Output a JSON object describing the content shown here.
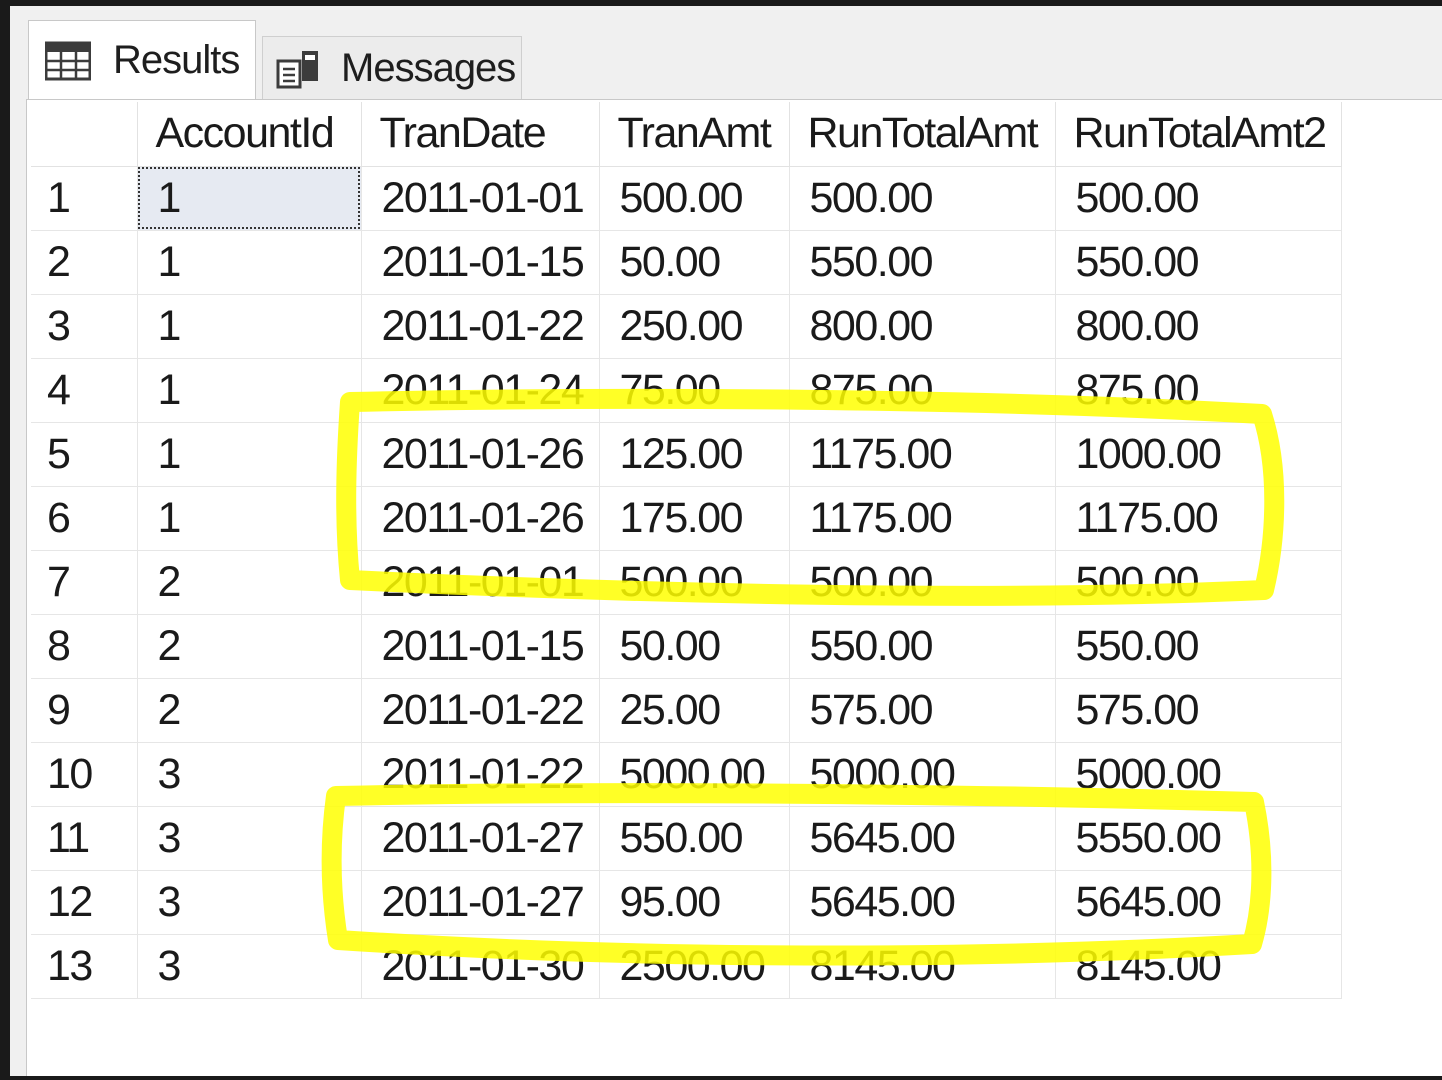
{
  "tabs": [
    {
      "label": "Results",
      "icon": "grid-icon",
      "active": true
    },
    {
      "label": "Messages",
      "icon": "messages-icon",
      "active": false
    }
  ],
  "grid": {
    "columns": [
      "AccountId",
      "TranDate",
      "TranAmt",
      "RunTotalAmt",
      "RunTotalAmt2"
    ],
    "rows": [
      {
        "num": "1",
        "cells": [
          "1",
          "2011-01-01",
          "500.00",
          "500.00",
          "500.00"
        ]
      },
      {
        "num": "2",
        "cells": [
          "1",
          "2011-01-15",
          "50.00",
          "550.00",
          "550.00"
        ]
      },
      {
        "num": "3",
        "cells": [
          "1",
          "2011-01-22",
          "250.00",
          "800.00",
          "800.00"
        ]
      },
      {
        "num": "4",
        "cells": [
          "1",
          "2011-01-24",
          "75.00",
          "875.00",
          "875.00"
        ]
      },
      {
        "num": "5",
        "cells": [
          "1",
          "2011-01-26",
          "125.00",
          "1175.00",
          "1000.00"
        ]
      },
      {
        "num": "6",
        "cells": [
          "1",
          "2011-01-26",
          "175.00",
          "1175.00",
          "1175.00"
        ]
      },
      {
        "num": "7",
        "cells": [
          "2",
          "2011-01-01",
          "500.00",
          "500.00",
          "500.00"
        ]
      },
      {
        "num": "8",
        "cells": [
          "2",
          "2011-01-15",
          "50.00",
          "550.00",
          "550.00"
        ]
      },
      {
        "num": "9",
        "cells": [
          "2",
          "2011-01-22",
          "25.00",
          "575.00",
          "575.00"
        ]
      },
      {
        "num": "10",
        "cells": [
          "3",
          "2011-01-22",
          "5000.00",
          "5000.00",
          "5000.00"
        ]
      },
      {
        "num": "11",
        "cells": [
          "3",
          "2011-01-27",
          "550.00",
          "5645.00",
          "5550.00"
        ]
      },
      {
        "num": "12",
        "cells": [
          "3",
          "2011-01-27",
          "95.00",
          "5645.00",
          "5645.00"
        ]
      },
      {
        "num": "13",
        "cells": [
          "3",
          "2011-01-30",
          "2500.00",
          "8145.00",
          "8145.00"
        ]
      }
    ],
    "selected_cell": {
      "row": 1,
      "column": "AccountId"
    }
  },
  "annotations": {
    "highlight_color": "#ffff00",
    "highlighted_rows": [
      [
        5,
        6
      ],
      [
        11,
        12
      ]
    ]
  }
}
